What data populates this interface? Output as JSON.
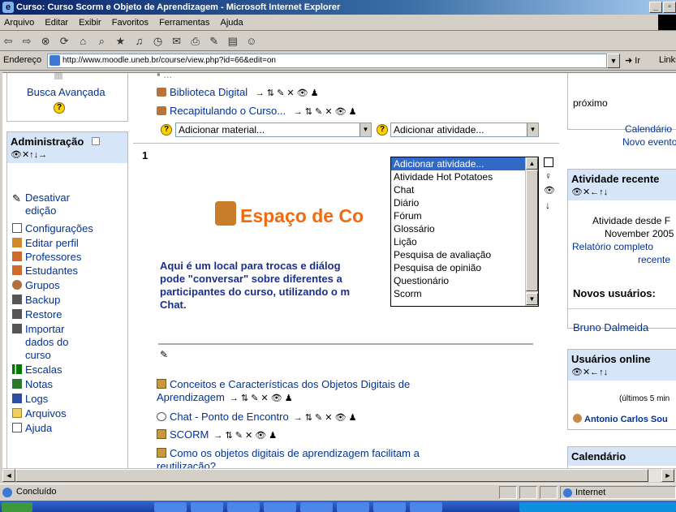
{
  "window": {
    "title": "Curso: Curso Scorm e Objeto de Aprendizagem - Microsoft Internet Explorer"
  },
  "menu": [
    "Arquivo",
    "Editar",
    "Exibir",
    "Favoritos",
    "Ferramentas",
    "Ajuda"
  ],
  "address": {
    "label": "Endereço",
    "url": "http://www.moodle.uneb.br/course/view.php?id=66&edit=on",
    "go": "Ir",
    "links": "Links"
  },
  "left": {
    "busca": "Busca Avançada",
    "admin_title": "Administração",
    "admin_tools": "👁✕↑↓→",
    "items": [
      {
        "label": "Desativar"
      },
      {
        "label": "edição"
      },
      {
        "label": "Configurações"
      },
      {
        "label": "Editar perfil"
      },
      {
        "label": "Professores"
      },
      {
        "label": "Estudantes"
      },
      {
        "label": "Grupos"
      },
      {
        "label": "Backup"
      },
      {
        "label": "Restore"
      },
      {
        "label": "Importar"
      },
      {
        "label": "dados do"
      },
      {
        "label": "curso"
      },
      {
        "label": "Escalas"
      },
      {
        "label": "Notas"
      },
      {
        "label": "Logs"
      },
      {
        "label": "Arquivos"
      },
      {
        "label": "Ajuda"
      }
    ]
  },
  "main": {
    "top_links": [
      "Biblioteca Digital",
      "Recapitulando o Curso..."
    ],
    "edit_icons": "→ ⇅ ✎ ✕ 👁 ♟",
    "add_material": "Adicionar material...",
    "add_activity": "Adicionar atividade...",
    "dropdown": [
      "Adicionar atividade...",
      "Atividade Hot Potatoes",
      "Chat",
      "Diário",
      "Fórum",
      "Glossário",
      "Lição",
      "Pesquisa de avaliação",
      "Pesquisa de opinião",
      "Questionário",
      "Scorm"
    ],
    "section_number": "1",
    "banner": "Espaço de Co",
    "description": [
      "Aqui é um local para trocas e diálog",
      "pode \"conversar\" sobre diferentes a",
      "participantes do curso, utilizando o m",
      "Chat."
    ],
    "links": [
      {
        "label": "Conceitos e Características dos Objetos Digitais de",
        "label2": "Aprendizagem"
      },
      {
        "label": "Chat - Ponto de Encontro"
      },
      {
        "label": "SCORM"
      },
      {
        "label": "Como os objetos digitais de aprendizagem facilitam a",
        "label2": "reutilização?"
      }
    ]
  },
  "right": {
    "proximo": "próximo",
    "calendario_link": "Calendário",
    "novo_evento": "Novo evento",
    "atividade_title": "Atividade recente",
    "atividade_desde": "Atividade desde F",
    "atividade_data": "November 2005",
    "relatorio": "Relatório completo",
    "recente": "recente",
    "novos_usuarios": "Novos usuários:",
    "usuario": "Bruno Dalmeida",
    "usuarios_online": "Usuários online",
    "ultimos": "(últimos 5 min",
    "online_user": "Antonio Carlos Sou",
    "calendario_title": "Calendário"
  },
  "status": {
    "text": "Concluído",
    "zone": "Internet"
  }
}
